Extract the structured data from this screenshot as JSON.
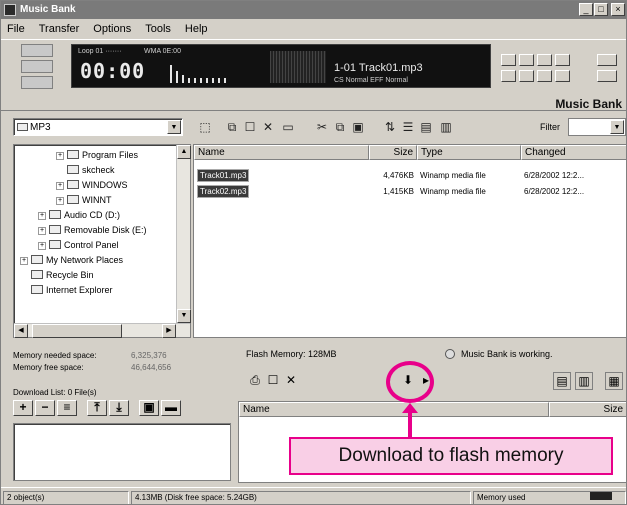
{
  "window": {
    "title": "Music Bank",
    "controls": [
      "_",
      "□",
      "×"
    ]
  },
  "menu": [
    "File",
    "Transfer",
    "Options",
    "Tools",
    "Help"
  ],
  "player": {
    "lcd_top_left": "Loop 01 ·······",
    "lcd_top_mid": "WMA   0E:00",
    "time": "00:00",
    "track": "1-01 Track01.mp3",
    "lcd_sub": "CS Normal  EFF Normal",
    "brand": "Music Bank"
  },
  "toolbar": {
    "path": "MP3",
    "filter_label": "Filter",
    "icons": [
      "folder-up-icon",
      "copy-icon",
      "new-folder-icon",
      "delete-icon",
      "properties-icon",
      "cut-icon",
      "copy-icon",
      "paste-icon",
      "view-icon",
      "sort-icon",
      "list-icon",
      "details-icon",
      "info-icon"
    ]
  },
  "tree": {
    "items": [
      {
        "label": "Program Files",
        "indent": 2,
        "expander": "+"
      },
      {
        "label": "skcheck",
        "indent": 2,
        "expander": ""
      },
      {
        "label": "WINDOWS",
        "indent": 2,
        "expander": "+"
      },
      {
        "label": "WINNT",
        "indent": 2,
        "expander": "+"
      },
      {
        "label": "Audio CD (D:)",
        "indent": 1,
        "expander": "+"
      },
      {
        "label": "Removable Disk (E:)",
        "indent": 1,
        "expander": "+"
      },
      {
        "label": "Control Panel",
        "indent": 1,
        "expander": "+"
      },
      {
        "label": "My Network Places",
        "indent": 0,
        "expander": "+"
      },
      {
        "label": "Recycle Bin",
        "indent": 0,
        "expander": ""
      },
      {
        "label": "Internet Explorer",
        "indent": 0,
        "expander": ""
      }
    ]
  },
  "filelist": {
    "columns": [
      "Name",
      "Size",
      "Type",
      "Changed"
    ],
    "rows": [
      {
        "name": "Track01.mp3",
        "size": "4,476KB",
        "type": "Winamp media file",
        "changed": "6/28/2002 12:2..."
      },
      {
        "name": "Track02.mp3",
        "size": "1,415KB",
        "type": "Winamp media file",
        "changed": "6/28/2002 12:2..."
      }
    ]
  },
  "memory": {
    "needed_label": "Memory needed space:",
    "needed_value": "6,325,376",
    "free_label": "Memory free space:",
    "free_value": "46,644,656",
    "download_list_label": "Download List: 0 File(s)"
  },
  "flash": {
    "label": "Flash Memory: 128MB",
    "status": "Music Bank is working.",
    "columns": [
      "Name",
      "Size"
    ]
  },
  "statusbar": {
    "objects": "2 object(s)",
    "disk": "4.13MB (Disk free space: 5.24GB)",
    "memory_used": "Memory used"
  },
  "callout": {
    "text": "Download to flash memory"
  },
  "colors": {
    "callout": "#e8008a",
    "callout_fill": "#f9cfe6",
    "selection": "#3a3a3a"
  }
}
